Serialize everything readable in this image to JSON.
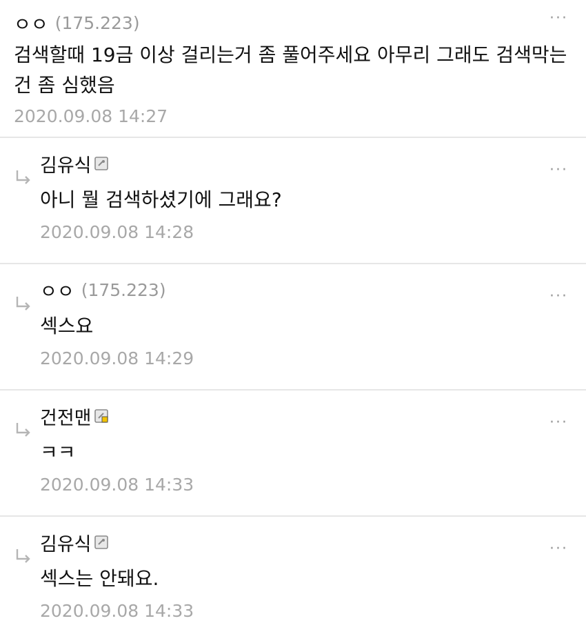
{
  "main_comment": {
    "nickname": "ㅇㅇ",
    "ip": "(175.223)",
    "content": "검색할때 19금 이상 걸리는거 좀 풀어주세요 아무리 그래도 검색막는건 좀 심했음",
    "date": "2020.09.08 14:27",
    "more": "···"
  },
  "replies": [
    {
      "nickname": "김유식",
      "ip": "",
      "content": "아니 뭘 검색하셨기에 그래요?",
      "date": "2020.09.08 14:28",
      "more": "···",
      "badge": "gallog-icon"
    },
    {
      "nickname": "ㅇㅇ",
      "ip": "(175.223)",
      "content": "섹스요",
      "date": "2020.09.08 14:29",
      "more": "···",
      "badge": ""
    },
    {
      "nickname": "건전맨",
      "ip": "",
      "content": "ㅋㅋ",
      "date": "2020.09.08 14:33",
      "more": "···",
      "badge": "fixed-member-icon"
    },
    {
      "nickname": "김유식",
      "ip": "",
      "content": "섹스는 안돼요.",
      "date": "2020.09.08 14:33",
      "more": "···",
      "badge": "gallog-icon"
    }
  ]
}
